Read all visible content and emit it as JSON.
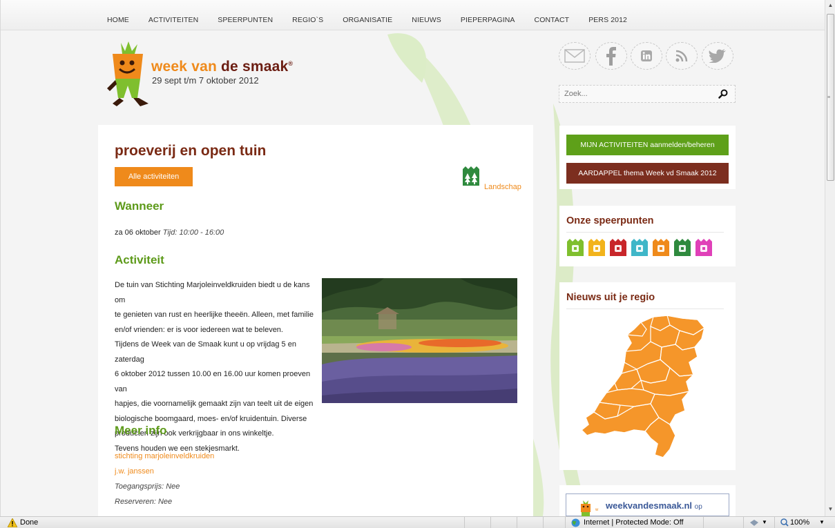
{
  "nav": {
    "items": [
      "HOME",
      "ACTIVITEITEN",
      "SPEERPUNTEN",
      "REGIO`S",
      "ORGANISATIE",
      "NIEUWS",
      "PIEPERPAGINA",
      "CONTACT",
      "PERS 2012"
    ]
  },
  "logo": {
    "brand_part1": "week van ",
    "brand_part2": "de smaak",
    "registered": "®",
    "dates": "29 sept  t/m 7 oktober 2012"
  },
  "social": {
    "icons": [
      "mail-icon",
      "facebook-icon",
      "linkedin-icon",
      "rss-icon",
      "twitter-icon"
    ]
  },
  "search": {
    "placeholder": "Zoek...",
    "value": ""
  },
  "article": {
    "title": "proeverij en open tuin",
    "all_activities_button": "Alle activiteiten",
    "category_label": "Landschap",
    "when_heading": "Wanneer",
    "date": "za 06 oktober",
    "time": "Tijd: 10:00 - 16:00",
    "activity_heading": "Activiteit",
    "paragraph_lines": [
      "De tuin van Stichting Marjoleinveldkruiden biedt u de kans om",
      "te genieten van rust en heerlijke theeën. Alleen, met familie",
      "en/of vrienden: er is voor iedereen wat te beleven.",
      "Tijdens de Week van de Smaak kunt u op vrijdag 5 en zaterdag",
      "6 oktober 2012 tussen 10.00 en 16.00 uur komen proeven van",
      "hapjes, die voornamelijk gemaakt zijn van teelt uit de eigen",
      "biologische boomgaard, moes- en/of kruidentuin. Diverse",
      "producten zijn ook verkrijgbaar in ons winkeltje.",
      "Tevens houden we een stekjesmarkt."
    ],
    "more_info_heading": "Meer info",
    "link1": "stichting marjoleinveldkruiden",
    "link2": "j.w. janssen",
    "entry_fee": "Toegangsprijs: Nee",
    "reservation": "Reserveren: Nee"
  },
  "sidebar": {
    "my_activities_button": "MIJN ACTIVITEITEN aanmelden/beheren",
    "potato_theme_button": "AARDAPPEL thema Week vd Smaak 2012",
    "focus_title": "Onze speerpunten",
    "focus_colors": [
      "#7fbf2e",
      "#f2b31b",
      "#c8262a",
      "#3fb6c8",
      "#ef8a1b",
      "#2f8a3e",
      "#e040b8"
    ],
    "region_title": "Nieuws uit je regio",
    "facebook_title": "weekvandesmaak.nl",
    "facebook_suffix": "op"
  },
  "colors": {
    "green_button": "#5ea019",
    "brown_button": "#7c2e1f",
    "orange": "#ef8a1b",
    "title_brown": "#7a2a14",
    "heading_green": "#5d9a1a"
  },
  "statusbar": {
    "status": "Done",
    "zone": "Internet | Protected Mode: Off",
    "zoom": "100%"
  }
}
